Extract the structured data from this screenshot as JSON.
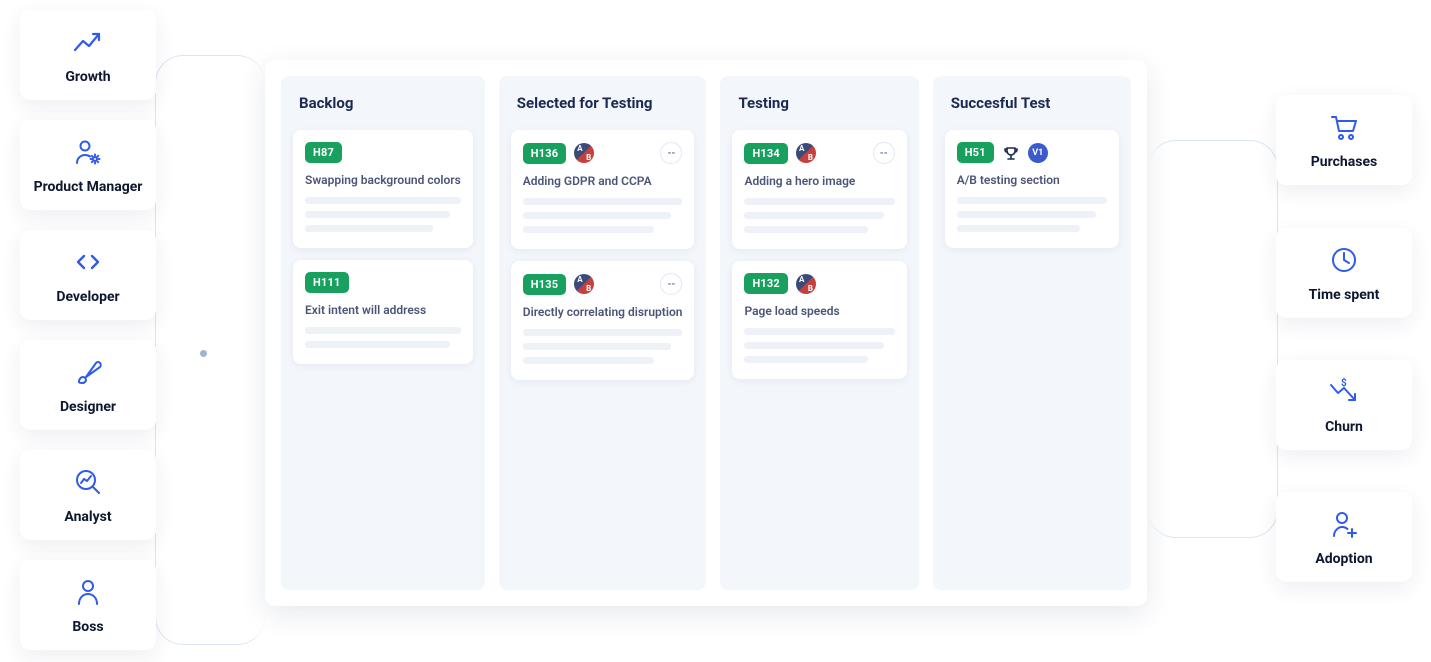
{
  "roles": [
    {
      "label": "Growth",
      "icon": "growth"
    },
    {
      "label": "Product Manager",
      "icon": "pm"
    },
    {
      "label": "Developer",
      "icon": "dev"
    },
    {
      "label": "Designer",
      "icon": "designer"
    },
    {
      "label": "Analyst",
      "icon": "analyst"
    },
    {
      "label": "Boss",
      "icon": "boss"
    }
  ],
  "metrics": [
    {
      "label": "Purchases",
      "icon": "cart"
    },
    {
      "label": "Time spent",
      "icon": "clock"
    },
    {
      "label": "Churn",
      "icon": "churn"
    },
    {
      "label": "Adoption",
      "icon": "adoption"
    }
  ],
  "board": {
    "columns": [
      {
        "title": "Backlog",
        "cards": [
          {
            "tag": "H87",
            "title": "Swapping background colors",
            "ab": false,
            "dash": false,
            "trophy": false,
            "v": null,
            "lines": 3
          },
          {
            "tag": "H111",
            "title": "Exit intent will address",
            "ab": false,
            "dash": false,
            "trophy": false,
            "v": null,
            "lines": 2
          }
        ]
      },
      {
        "title": "Selected for Testing",
        "cards": [
          {
            "tag": "H136",
            "title": "Adding GDPR and CCPA",
            "ab": true,
            "dash": true,
            "trophy": false,
            "v": null,
            "lines": 3
          },
          {
            "tag": "H135",
            "title": "Directly correlating disruption",
            "ab": true,
            "dash": true,
            "trophy": false,
            "v": null,
            "lines": 3
          }
        ]
      },
      {
        "title": "Testing",
        "cards": [
          {
            "tag": "H134",
            "title": "Adding a hero image",
            "ab": true,
            "dash": true,
            "trophy": false,
            "v": null,
            "lines": 3
          },
          {
            "tag": "H132",
            "title": "Page load speeds",
            "ab": true,
            "dash": false,
            "trophy": false,
            "v": null,
            "lines": 3
          }
        ]
      },
      {
        "title": "Succesful Test",
        "cards": [
          {
            "tag": "H51",
            "title": "A/B testing section",
            "ab": false,
            "dash": false,
            "trophy": true,
            "v": "V1",
            "lines": 3
          }
        ]
      }
    ]
  }
}
